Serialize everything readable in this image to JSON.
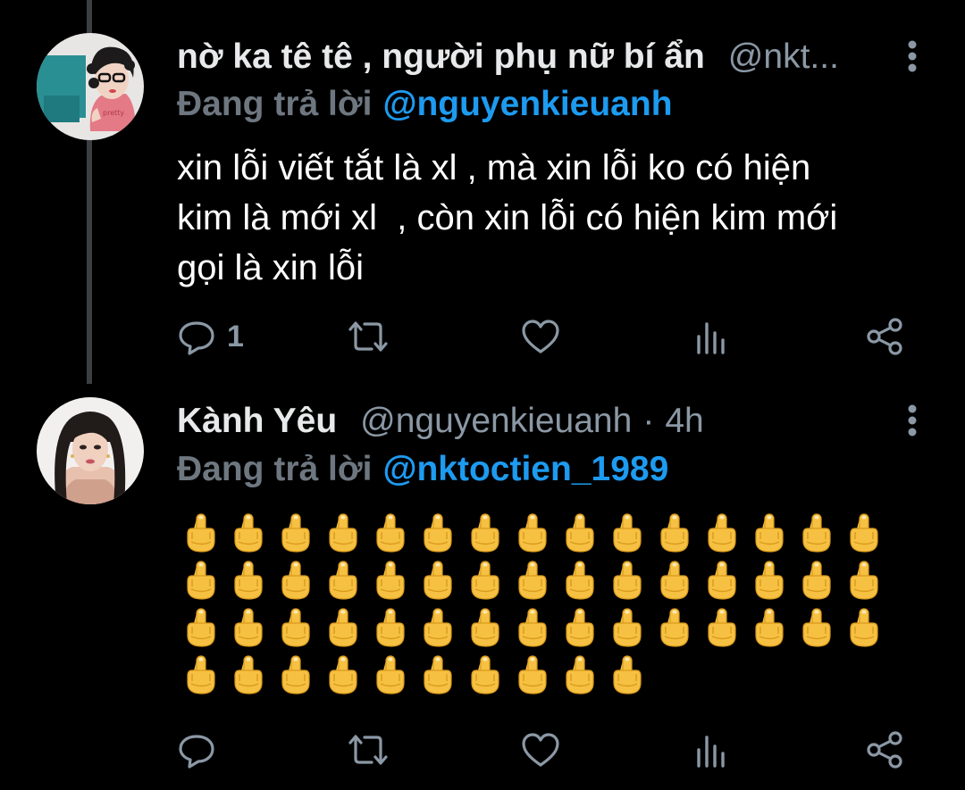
{
  "tweets": [
    {
      "display_name": "nờ ka tê tê , người phụ nữ bí ẩn",
      "handle": "@nkt...",
      "reply_prefix": "Đang trả lời",
      "reply_target": "@nguyenkieuanh",
      "text": "xin lỗi viết tắt là xl , mà xin lỗi ko có hiện\nkim là mới xl  , còn xin lỗi có hiện kim mới\ngọi là xin lỗi",
      "reply_count": "1",
      "avatar_icon": "avatar-photo-icon"
    },
    {
      "display_name": "Kành Yêu",
      "handle": "@nguyenkieuanh",
      "separator": "·",
      "time": "4h",
      "reply_prefix": "Đang trả lời",
      "reply_target": "@nkt",
      "reply_target_suffix": "octien_1989",
      "emoji_count": 55,
      "emoji_name": "middle-finger-emoji",
      "avatar_icon": "avatar-photo-icon"
    }
  ],
  "colors": {
    "background": "#000000",
    "primary_text": "#e7e9ea",
    "secondary_text": "#8b98a5",
    "link": "#1d9bf0",
    "thread_line": "#3a3f44"
  }
}
